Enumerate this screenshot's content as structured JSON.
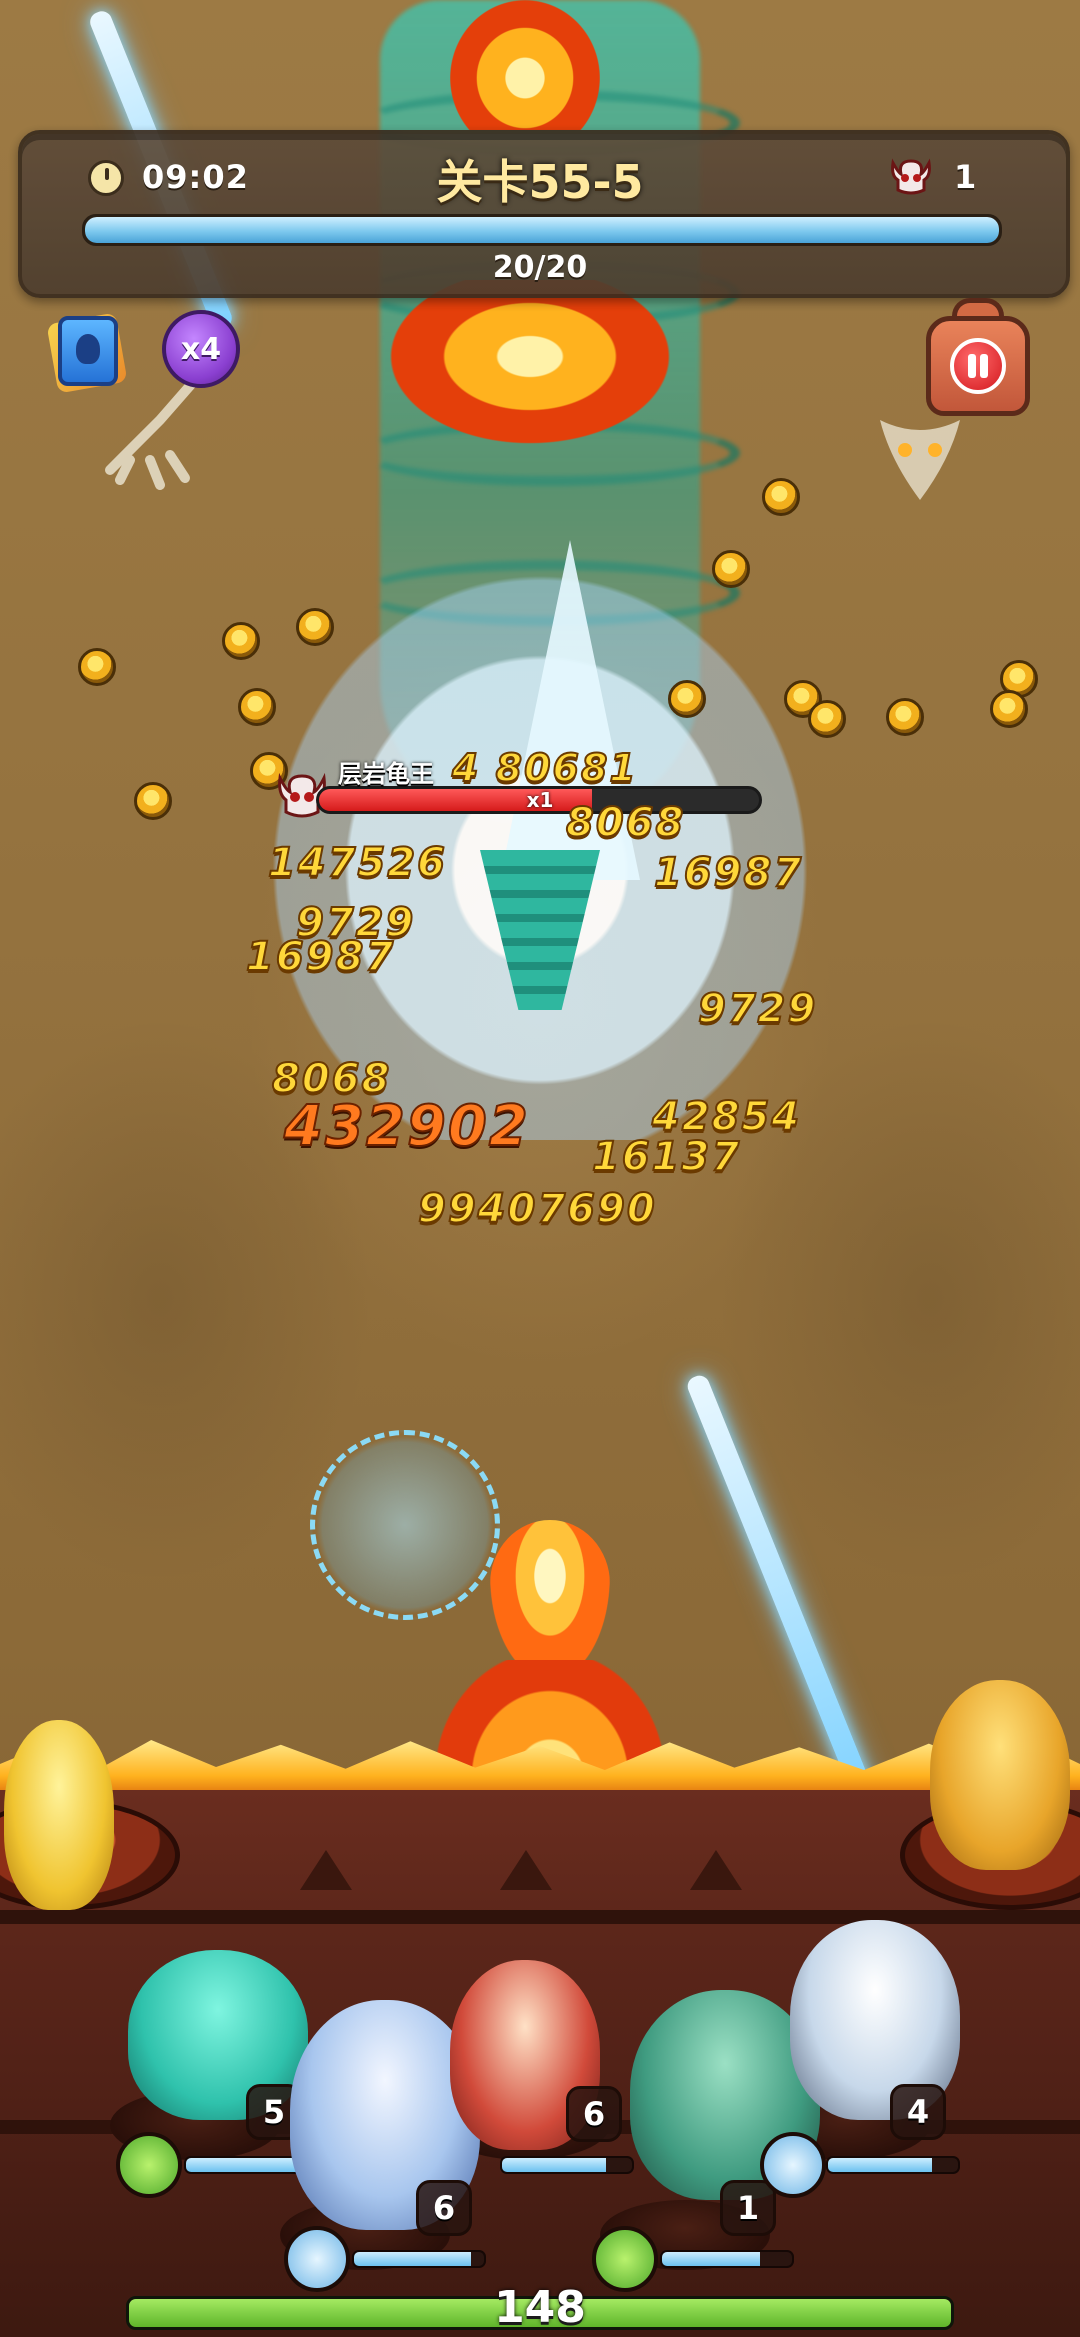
{
  "hud": {
    "timer": "09:02",
    "level_title": "关卡55-5",
    "kill_count": "1",
    "wave_progress_text": "20/20",
    "wave_progress": 1.0
  },
  "buttons": {
    "speed_label": "x4"
  },
  "boss": {
    "name": "层岩龟王",
    "hp_multiplier": "x1",
    "hp_fraction": 0.62
  },
  "damage_numbers": [
    "4 80681",
    "8068",
    "147526",
    "16987",
    "9729",
    "16987",
    "9729",
    "8068",
    "432902",
    "42854",
    "16137",
    "99407690"
  ],
  "heroes": [
    {
      "level": "5",
      "skill_icon": "wind-icon",
      "bar": 0.85
    },
    {
      "level": "6",
      "skill_icon": "ice-crystal-icon",
      "bar": 0.9
    },
    {
      "level": "6",
      "skill_icon": "",
      "bar": 0.8
    },
    {
      "level": "1",
      "skill_icon": "wind-icon",
      "bar": 0.75
    },
    {
      "level": "4",
      "skill_icon": "ice-crystal-icon",
      "bar": 0.8
    }
  ],
  "base_hp": {
    "value": "148",
    "fraction": 1.0
  },
  "colors": {
    "boss_hp": "#d51b1b",
    "wave_bar": "#7ec9ee",
    "base_hp_bar": "#5fb52a",
    "damage_text": "#ffd83a",
    "level_title": "#ffe9a0"
  }
}
